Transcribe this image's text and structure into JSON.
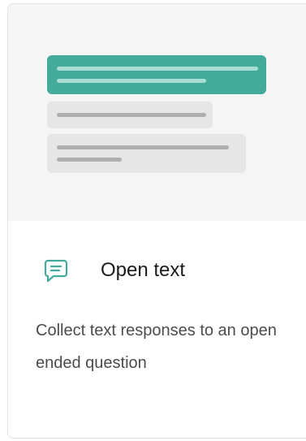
{
  "card": {
    "title": "Open text",
    "description": "Collect text responses to an open ended question",
    "icon": "message-text-icon"
  },
  "colors": {
    "accent": "#44ab9b",
    "preview_background": "#f5f5f5",
    "placeholder": "#e6e6e6",
    "title_text": "#1b1b1b",
    "description_text": "#4c4c4c"
  }
}
